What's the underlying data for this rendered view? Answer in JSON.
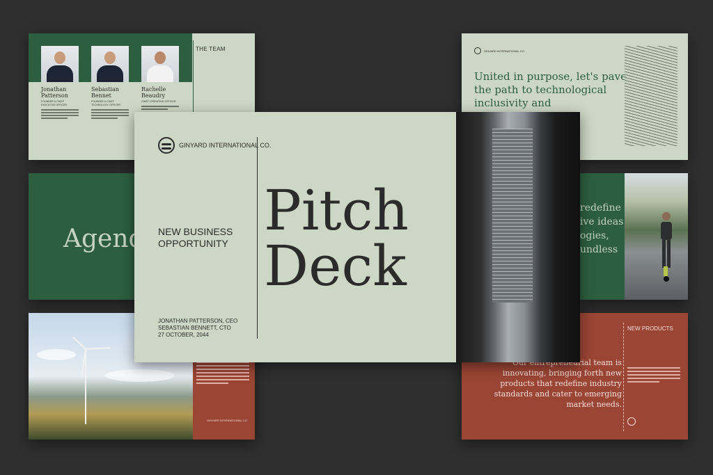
{
  "colors": {
    "background": "#2f2f2f",
    "sage": "#cdd7c5",
    "forest": "#2c5e3f",
    "terracotta": "#9b4535",
    "ink": "#2b2b2b"
  },
  "team_slide": {
    "label": "THE TEAM",
    "members": [
      {
        "name": "Jonathan Patterson",
        "role": "FOUNDER & CHIEF EXECUTIVE OFFICER"
      },
      {
        "name": "Sebastian Bennet",
        "role": "FOUNDER & CHIEF TECHNOLOGY OFFICER"
      },
      {
        "name": "Rachelle Beaudry",
        "role": "CHIEF OPERATING OFFICER"
      }
    ]
  },
  "agenda_slide": {
    "title": "Agenda"
  },
  "main_slide": {
    "company": "GINYARD INTERNATIONAL CO.",
    "subtitle_line1": "NEW BUSINESS",
    "subtitle_line2": "OPPORTUNITY",
    "credit_1": "JONATHAN PATTERSON, CEO",
    "credit_2": "SEBASTIAN BENNETT, CTO",
    "date": "27 OCTOBER, 2044",
    "title_line1": "Pitch",
    "title_line2": "Deck"
  },
  "purpose_slide": {
    "company": "GINYARD INTERNATIONAL CO.",
    "quote": "United in purpose, let's pave the path to technological inclusivity and empowerment."
  },
  "innovation_slide": {
    "text": "redefine\nive ideas\nogies,\nundless"
  },
  "wind_slide": {
    "footer": "GINYARD INTERNATIONAL CO."
  },
  "products_slide": {
    "label": "NEW PRODUCTS",
    "quote": "Our entrepreneurial team is innovating, bringing forth new products that redefine industry standards and cater to emerging market needs."
  }
}
